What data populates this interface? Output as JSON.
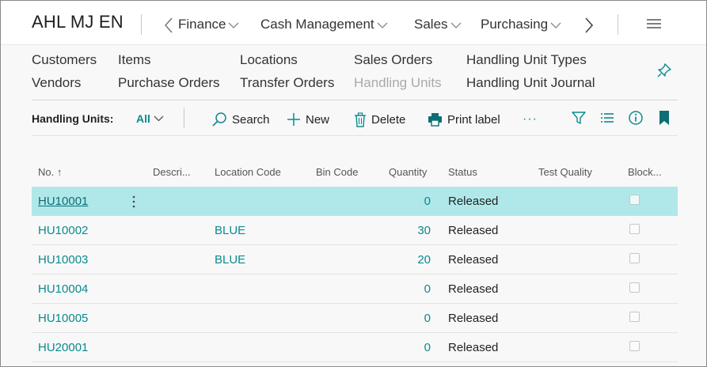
{
  "header": {
    "company": "AHL MJ EN",
    "menu": [
      {
        "label": "Finance"
      },
      {
        "label": "Cash Management"
      },
      {
        "label": "Sales"
      },
      {
        "label": "Purchasing"
      }
    ]
  },
  "navigation": {
    "links": [
      {
        "label": "Customers"
      },
      {
        "label": "Vendors"
      },
      {
        "label": "Items"
      },
      {
        "label": "Purchase Orders"
      },
      {
        "label": "Locations"
      },
      {
        "label": "Transfer Orders"
      },
      {
        "label": "Sales Orders"
      },
      {
        "label": "Handling Units"
      },
      {
        "label": "Handling Unit Types"
      },
      {
        "label": "Handling Unit Journal"
      }
    ]
  },
  "actionbar": {
    "title": "Handling Units:",
    "filter": "All",
    "search": "Search",
    "new": "New",
    "delete": "Delete",
    "print_label": "Print label",
    "more": "···"
  },
  "table": {
    "columns": [
      "No. ↑",
      "Descri...",
      "Location Code",
      "Bin Code",
      "Quantity",
      "Status",
      "Test Quality",
      "Block..."
    ],
    "rows": [
      {
        "no": "HU10001",
        "location": "",
        "quantity": "0",
        "status": "Released",
        "blocked": false
      },
      {
        "no": "HU10002",
        "location": "BLUE",
        "quantity": "30",
        "status": "Released",
        "blocked": false
      },
      {
        "no": "HU10003",
        "location": "BLUE",
        "quantity": "20",
        "status": "Released",
        "blocked": false
      },
      {
        "no": "HU10004",
        "location": "",
        "quantity": "0",
        "status": "Released",
        "blocked": false
      },
      {
        "no": "HU10005",
        "location": "",
        "quantity": "0",
        "status": "Released",
        "blocked": false
      },
      {
        "no": "HU20001",
        "location": "",
        "quantity": "0",
        "status": "Released",
        "blocked": false
      }
    ]
  },
  "colors": {
    "accent": "#0b8a8f",
    "selected_row": "#b0e8ea"
  }
}
